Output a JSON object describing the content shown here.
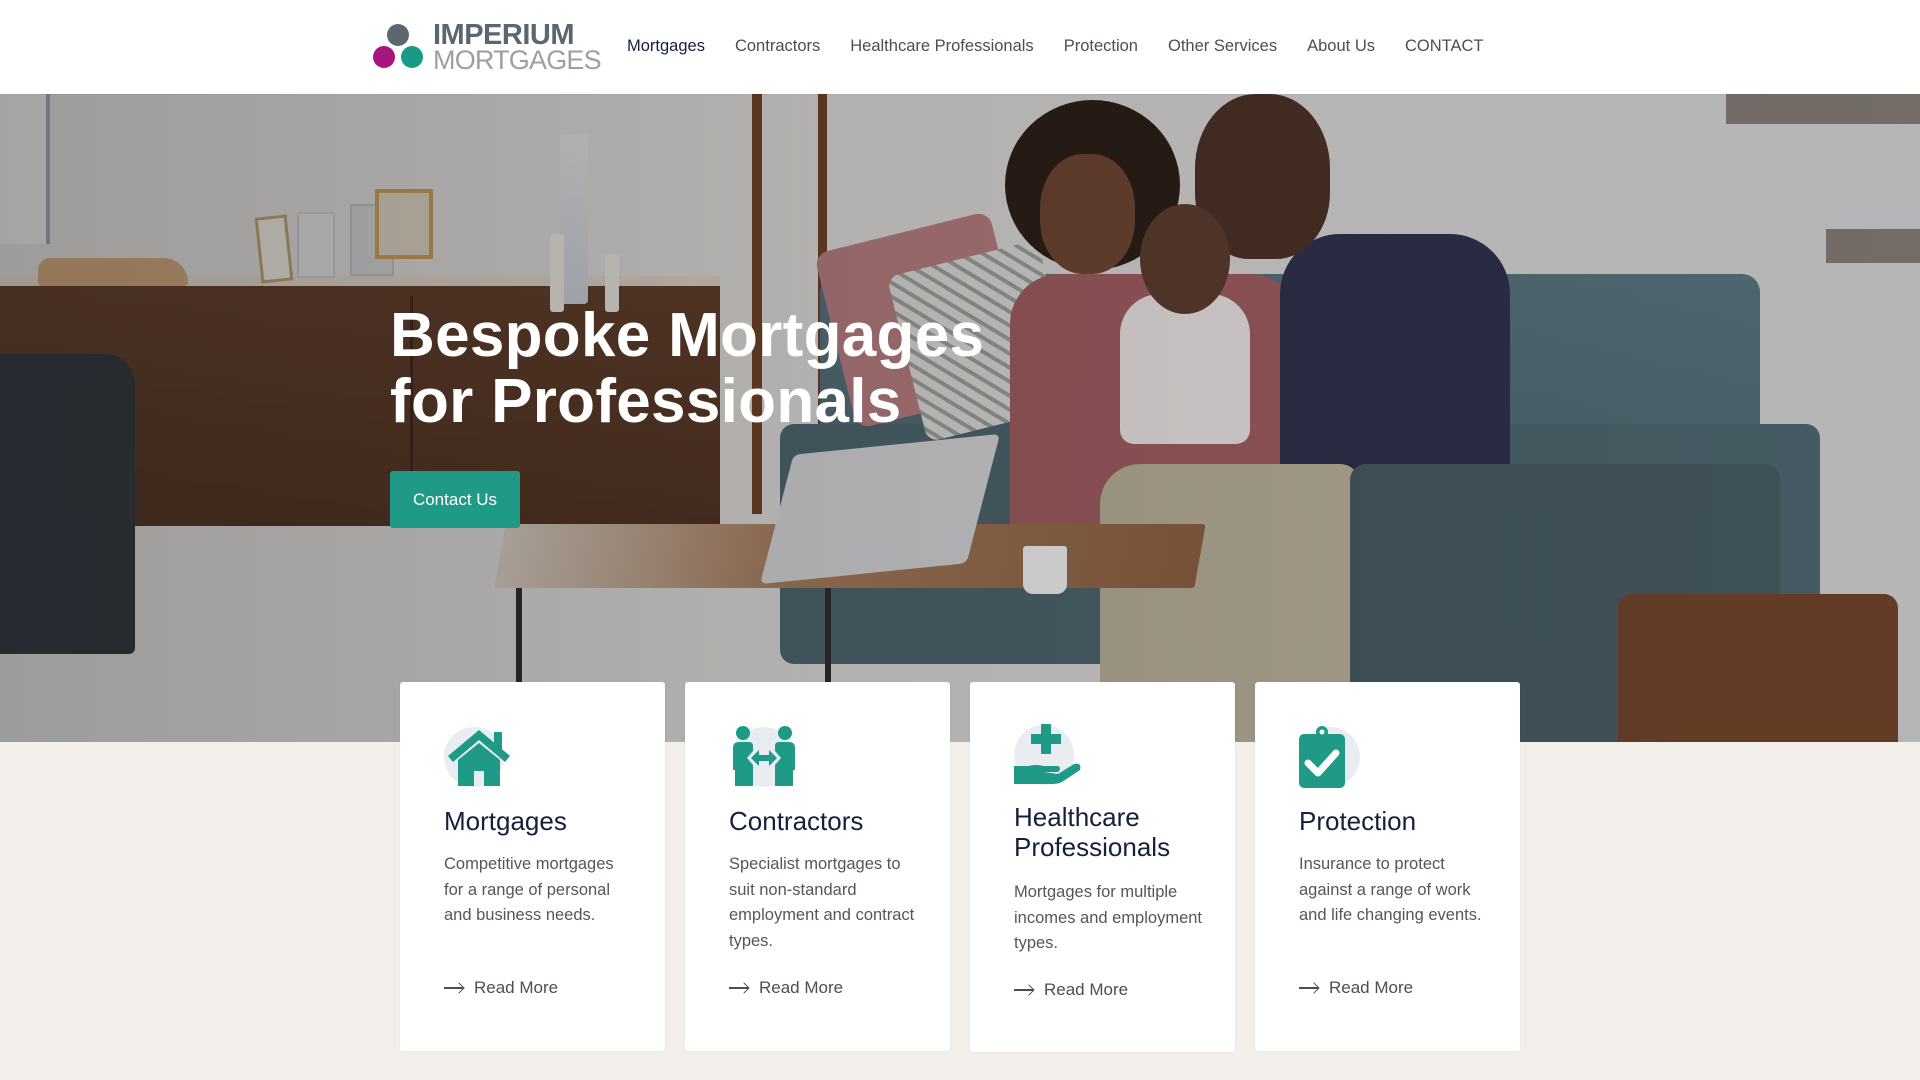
{
  "brand": {
    "name_line1": "IMPERIUM",
    "name_line2": "MORTGAGES",
    "colors": {
      "gray": "#5c6770",
      "magenta": "#a8157e",
      "teal": "#189a86"
    }
  },
  "nav": {
    "items": [
      {
        "label": "Mortgages",
        "active": true
      },
      {
        "label": "Contractors",
        "active": false
      },
      {
        "label": "Healthcare Professionals",
        "active": false
      },
      {
        "label": "Protection",
        "active": false
      },
      {
        "label": "Other Services",
        "active": false
      },
      {
        "label": "About Us",
        "active": false
      },
      {
        "label": "CONTACT",
        "active": false
      }
    ]
  },
  "hero": {
    "title_line1": "Bespoke Mortgages",
    "title_line2": "for Professionals",
    "cta_label": "Contact Us",
    "accent": "#1e9a87"
  },
  "cards": [
    {
      "icon": "house-icon",
      "title": "Mortgages",
      "text": "Competitive mortgages for a range of personal and business needs.",
      "link": "Read More"
    },
    {
      "icon": "people-exchange-icon",
      "title": "Contractors",
      "text": "Specialist mortgages to suit non-standard employment and contract types.",
      "link": "Read More"
    },
    {
      "icon": "hand-medical-cross-icon",
      "title": "Healthcare Professionals",
      "text": "Mortgages for multiple incomes and employment types.",
      "link": "Read More"
    },
    {
      "icon": "clipboard-check-icon",
      "title": "Protection",
      "text": "Insurance to protect against a range of work and life changing events.",
      "link": "Read More"
    }
  ]
}
